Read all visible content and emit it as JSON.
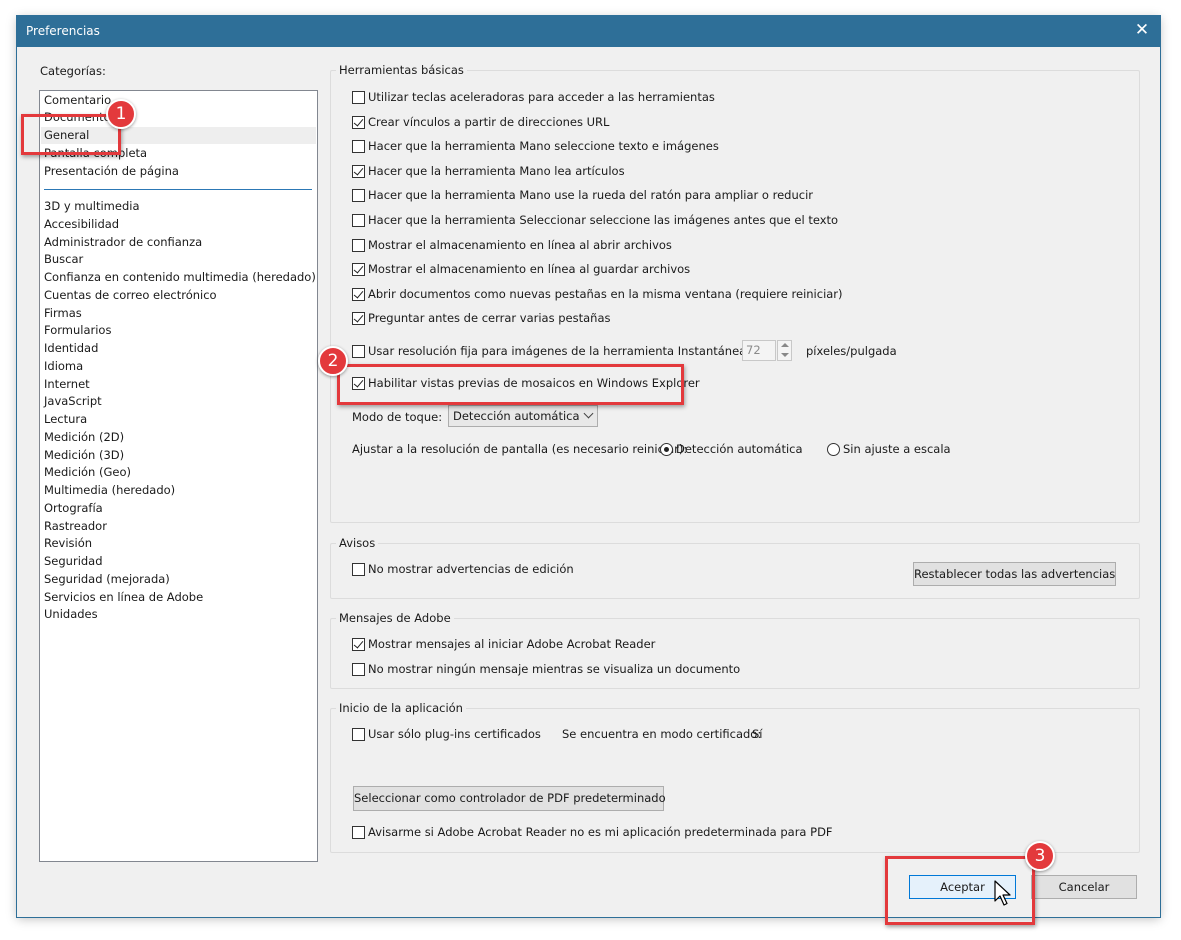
{
  "window": {
    "title": "Preferencias",
    "close": "✕"
  },
  "categories": {
    "label": "Categorías:",
    "top_items": [
      "Comentario",
      "Documentos",
      "General",
      "Pantalla completa",
      "Presentación de página"
    ],
    "items": [
      "3D y multimedia",
      "Accesibilidad",
      "Administrador de confianza",
      "Buscar",
      "Confianza en contenido multimedia (heredado)",
      "Cuentas de correo electrónico",
      "Firmas",
      "Formularios",
      "Identidad",
      "Idioma",
      "Internet",
      "JavaScript",
      "Lectura",
      "Medición (2D)",
      "Medición (3D)",
      "Medición (Geo)",
      "Multimedia (heredado)",
      "Ortografía",
      "Rastreador",
      "Revisión",
      "Seguridad",
      "Seguridad (mejorada)",
      "Servicios en línea de Adobe",
      "Unidades"
    ],
    "selected": "General"
  },
  "basic_tools": {
    "title": "Herramientas básicas",
    "checkboxes": [
      {
        "label": "Utilizar teclas aceleradoras para acceder a las herramientas",
        "checked": false
      },
      {
        "label": "Crear vínculos a partir de direcciones URL",
        "checked": true
      },
      {
        "label": "Hacer que la herramienta Mano seleccione texto e imágenes",
        "checked": false
      },
      {
        "label": "Hacer que la herramienta Mano lea artículos",
        "checked": true
      },
      {
        "label": "Hacer que la herramienta Mano use la rueda del ratón para ampliar o reducir",
        "checked": false
      },
      {
        "label": "Hacer que la herramienta Seleccionar seleccione las imágenes antes que el texto",
        "checked": false
      },
      {
        "label": "Mostrar el almacenamiento en línea al abrir archivos",
        "checked": false
      },
      {
        "label": "Mostrar el almacenamiento en línea al guardar archivos",
        "checked": true
      },
      {
        "label": "Abrir documentos como nuevas pestañas en la misma ventana (requiere reiniciar)",
        "checked": true
      },
      {
        "label": "Preguntar antes de cerrar varias pestañas",
        "checked": true
      }
    ],
    "fixed_resolution": {
      "label": "Usar resolución fija para imágenes de la herramienta Instantánea:",
      "checked": false,
      "value": "72",
      "unit": "píxeles/pulgada"
    },
    "thumbnails": {
      "label": "Habilitar vistas previas de mosaicos en Windows Explorer",
      "checked": true
    },
    "touch_mode": {
      "label": "Modo de toque:",
      "value": "Detección automática"
    },
    "scaling": {
      "label": "Ajustar a la resolución de pantalla (es necesario reiniciar):",
      "options": [
        "Detección automática",
        "Sin ajuste a escala"
      ],
      "selected": "Detección automática"
    }
  },
  "warnings": {
    "title": "Avisos",
    "checkbox": "No mostrar advertencias de edición",
    "reset_button": "Restablecer todas las advertencias"
  },
  "adobe_messages": {
    "title": "Mensajes de Adobe",
    "checkboxes": [
      {
        "label": "Mostrar mensajes al iniciar Adobe Acrobat Reader",
        "checked": true
      },
      {
        "label": "No mostrar ningún mensaje mientras se visualiza un documento",
        "checked": false
      }
    ]
  },
  "app_startup": {
    "title": "Inicio de la aplicación",
    "certified_plugins": "Usar sólo plug-ins certificados",
    "certified_mode_label": "Se encuentra en modo certificado:",
    "certified_mode_value": "Sí",
    "default_pdf_button": "Seleccionar como controlador de PDF predeterminado",
    "notify_default": "Avisarme si Adobe Acrobat Reader no es mi aplicación predeterminada para PDF"
  },
  "footer": {
    "ok": "Aceptar",
    "cancel": "Cancelar"
  },
  "annotations": {
    "badges": [
      "1",
      "2",
      "3"
    ],
    "color": "#e3393c"
  }
}
